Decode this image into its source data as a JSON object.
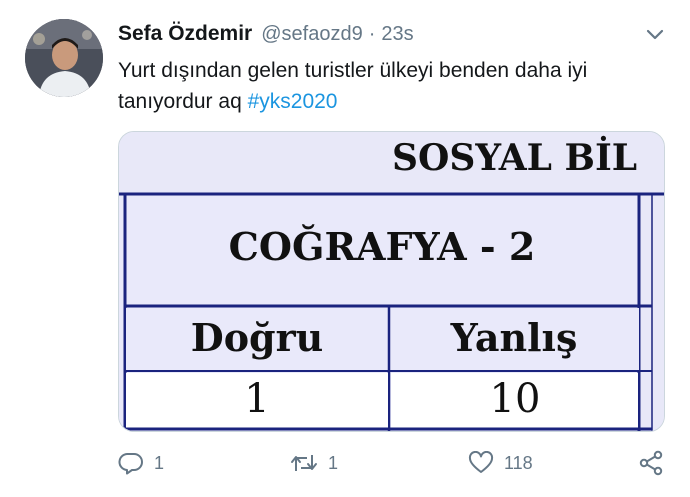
{
  "tweet": {
    "author_name": "Sefa Özdemir",
    "handle": "@sefaozd9",
    "separator": "·",
    "time": "23s",
    "text": "Yurt dışından gelen turistler ülkeyi benden daha iyi tanıyordur aq ",
    "hashtag": "#yks2020"
  },
  "media": {
    "header_text": "SOSYAL BİL",
    "subject_text": "COĞRAFYA - 2",
    "col_correct_label": "Doğru",
    "col_wrong_label": "Yanlış",
    "correct_value": "1",
    "wrong_value": "10"
  },
  "actions": {
    "reply_count": "1",
    "retweet_count": "1",
    "like_count": "118"
  },
  "icons": {
    "caret": "chevron-down-icon",
    "reply": "reply-icon",
    "retweet": "retweet-icon",
    "like": "heart-icon",
    "share": "share-icon"
  },
  "colors": {
    "text": "#14171a",
    "secondary": "#657786",
    "link": "#1b95e0",
    "media_background": "#e8e8f8",
    "table_border": "#1a237e"
  }
}
